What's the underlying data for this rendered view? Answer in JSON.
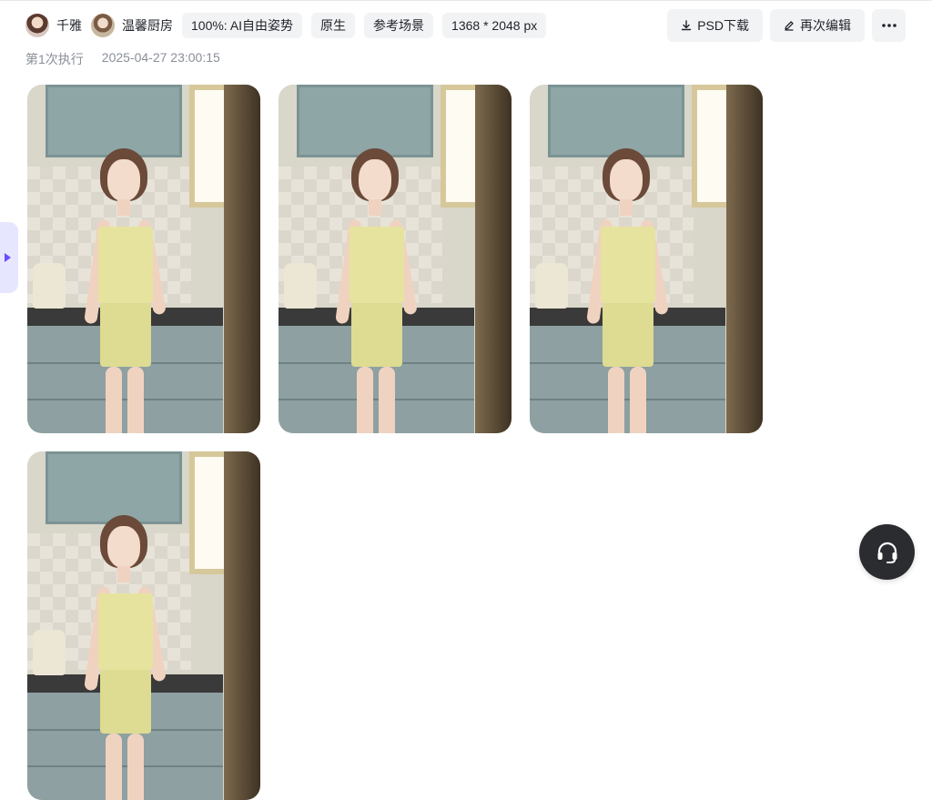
{
  "header": {
    "tags": [
      {
        "type": "avatar",
        "label": "千雅"
      },
      {
        "type": "avatar",
        "label": "温馨厨房"
      },
      {
        "type": "chip",
        "label": "100%: AI自由姿势"
      },
      {
        "type": "chip",
        "label": "原生"
      },
      {
        "type": "chip",
        "label": "参考场景"
      },
      {
        "type": "chip",
        "label": "1368 * 2048 px"
      }
    ],
    "actions": {
      "psd_download": "PSD下载",
      "re_edit": "再次编辑",
      "more": "···"
    },
    "meta": {
      "run_label": "第1次执行",
      "timestamp": "2025-04-27 23:00:15"
    }
  },
  "images": [
    {
      "name": "result-image-1"
    },
    {
      "name": "result-image-2"
    },
    {
      "name": "result-image-3"
    },
    {
      "name": "result-image-4"
    }
  ],
  "icons": {
    "download": "download-icon",
    "edit": "pen-icon",
    "more": "more-dots-icon",
    "expand": "expand-arrow-icon",
    "support": "headset-icon"
  },
  "colors": {
    "chip_bg": "#f2f3f5",
    "accent": "#6b4cff",
    "support_bg": "#2b2c30"
  }
}
